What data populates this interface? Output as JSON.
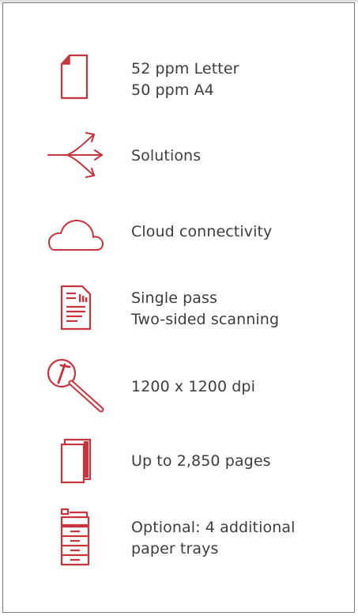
{
  "features": [
    {
      "icon": "document-page-icon",
      "lines": [
        "52 ppm Letter",
        "50 ppm A4"
      ]
    },
    {
      "icon": "branching-arrows-icon",
      "lines": [
        "Solutions"
      ]
    },
    {
      "icon": "cloud-icon",
      "lines": [
        "Cloud connectivity"
      ]
    },
    {
      "icon": "scanned-document-icon",
      "lines": [
        "Single pass",
        "Two-sided scanning"
      ]
    },
    {
      "icon": "magnifier-icon",
      "lines": [
        "1200 x 1200 dpi"
      ]
    },
    {
      "icon": "paper-stack-icon",
      "lines": [
        "Up to 2,850 pages"
      ]
    },
    {
      "icon": "printer-trays-icon",
      "lines": [
        "Optional: 4 additional",
        "paper trays"
      ]
    }
  ],
  "colors": {
    "accent": "#c8343e",
    "text": "#3d3d3d",
    "border": "#7a7a7a"
  }
}
